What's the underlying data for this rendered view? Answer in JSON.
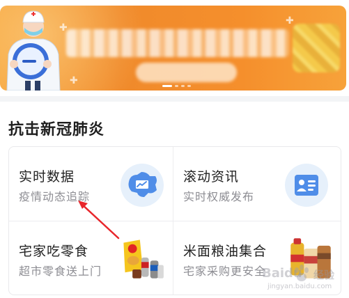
{
  "section": {
    "title": "抗击新冠肺炎"
  },
  "tiles": [
    {
      "title": "实时数据",
      "subtitle": "疫情动态追踪",
      "icon": "china-map-chart-icon"
    },
    {
      "title": "滚动资讯",
      "subtitle": "实时权威发布",
      "icon": "news-card-icon"
    },
    {
      "title": "宅家吃零食",
      "subtitle": "超市零食送上门",
      "icon": "snacks-image"
    },
    {
      "title": "米面粮油集合",
      "subtitle": "宅家采购更安全",
      "icon": "groceries-image"
    }
  ],
  "watermark": {
    "brand": "Baidu",
    "brand_cn": "经验",
    "url": "jingyan.baidu.com"
  },
  "colors": {
    "banner_orange": "#f08a2b",
    "icon_blue": "#4f8de8",
    "icon_bg": "#e6f0fb",
    "arrow_red": "#e8262b"
  }
}
